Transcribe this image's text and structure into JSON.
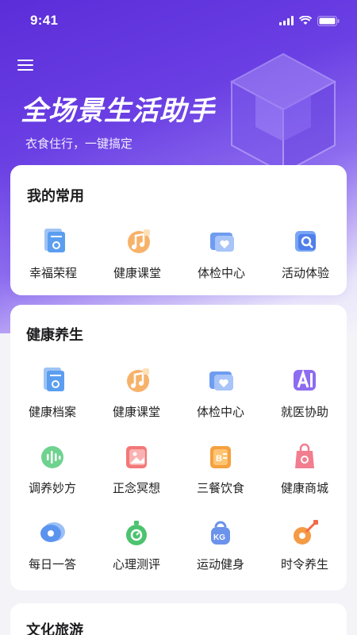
{
  "status": {
    "time": "9:41"
  },
  "hero": {
    "title": "全场景生活助手",
    "subtitle": "衣食住行，一键搞定"
  },
  "frequent": {
    "title": "我的常用",
    "items": [
      {
        "label": "幸福荣程",
        "icon": "receipt-icon"
      },
      {
        "label": "健康课堂",
        "icon": "music-note-icon"
      },
      {
        "label": "体检中心",
        "icon": "health-card-icon"
      },
      {
        "label": "活动体验",
        "icon": "search-book-icon"
      }
    ]
  },
  "health": {
    "title": "健康养生",
    "items": [
      {
        "label": "健康档案",
        "icon": "receipt-icon"
      },
      {
        "label": "健康课堂",
        "icon": "music-note-icon"
      },
      {
        "label": "体检中心",
        "icon": "health-card-icon"
      },
      {
        "label": "就医协助",
        "icon": "ai-icon"
      },
      {
        "label": "调养妙方",
        "icon": "audio-wave-icon"
      },
      {
        "label": "正念冥想",
        "icon": "picture-icon"
      },
      {
        "label": "三餐饮食",
        "icon": "menu-card-icon"
      },
      {
        "label": "健康商城",
        "icon": "shopping-bag-icon"
      },
      {
        "label": "每日一答",
        "icon": "chat-bubble-icon"
      },
      {
        "label": "心理测评",
        "icon": "stopwatch-icon"
      },
      {
        "label": "运动健身",
        "icon": "kettlebell-icon"
      },
      {
        "label": "时令养生",
        "icon": "guitar-icon"
      }
    ]
  },
  "culture": {
    "title": "文化旅游"
  },
  "colors": {
    "primary": "#5b2dd9",
    "text": "#222222"
  }
}
